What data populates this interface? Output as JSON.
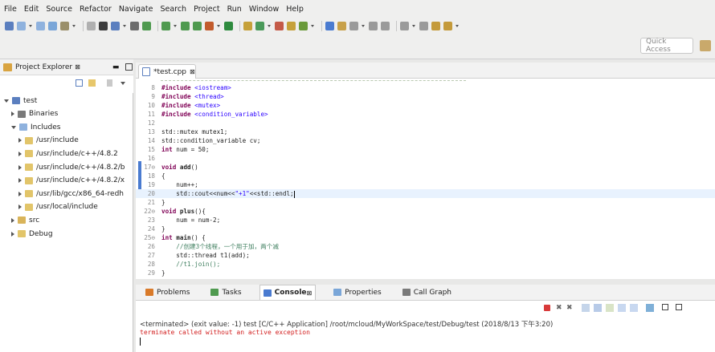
{
  "menu": [
    "File",
    "Edit",
    "Source",
    "Refactor",
    "Navigate",
    "Search",
    "Project",
    "Run",
    "Window",
    "Help"
  ],
  "quick_access": {
    "placeholder": "Quick Access"
  },
  "project_explorer": {
    "title": "Project Explorer",
    "close": "⊠",
    "tree": [
      {
        "label": "test",
        "arrow": "open",
        "indent": 0,
        "icon": "project-icon"
      },
      {
        "label": "Binaries",
        "arrow": "closed",
        "indent": 1,
        "icon": "binaries-icon"
      },
      {
        "label": "Includes",
        "arrow": "open",
        "indent": 1,
        "icon": "includes-icon"
      },
      {
        "label": "/usr/include",
        "arrow": "closed",
        "indent": 2,
        "icon": "folder-icon"
      },
      {
        "label": "/usr/include/c++/4.8.2",
        "arrow": "closed",
        "indent": 2,
        "icon": "folder-icon"
      },
      {
        "label": "/usr/include/c++/4.8.2/b",
        "arrow": "closed",
        "indent": 2,
        "icon": "folder-icon"
      },
      {
        "label": "/usr/include/c++/4.8.2/x",
        "arrow": "closed",
        "indent": 2,
        "icon": "folder-icon"
      },
      {
        "label": "/usr/lib/gcc/x86_64-redh",
        "arrow": "closed",
        "indent": 2,
        "icon": "folder-icon"
      },
      {
        "label": "/usr/local/include",
        "arrow": "closed",
        "indent": 2,
        "icon": "folder-icon"
      },
      {
        "label": "src",
        "arrow": "closed",
        "indent": 1,
        "icon": "source-folder-icon"
      },
      {
        "label": "Debug",
        "arrow": "closed",
        "indent": 1,
        "icon": "folder-icon"
      }
    ]
  },
  "editor": {
    "tab_label": "*test.cpp",
    "tab_close": "⊠",
    "lines": [
      {
        "num": "8",
        "html": "<span class=\"kw\">#include</span> <span class=\"str\">&lt;iostream&gt;</span>"
      },
      {
        "num": "9",
        "html": "<span class=\"kw\">#include</span> <span class=\"str\">&lt;thread&gt;</span>"
      },
      {
        "num": "10",
        "html": "<span class=\"kw\">#include</span> <span class=\"str\">&lt;mutex&gt;</span>"
      },
      {
        "num": "11",
        "html": "<span class=\"kw\">#include</span> <span class=\"str\">&lt;condition_variable&gt;</span>"
      },
      {
        "num": "12",
        "html": ""
      },
      {
        "num": "13",
        "html": "std::mutex mutex1;"
      },
      {
        "num": "14",
        "html": "std::condition_variable cv;"
      },
      {
        "num": "15",
        "html": "<span class=\"kw\">int</span> num = 50;"
      },
      {
        "num": "16",
        "html": ""
      },
      {
        "num": "17⊖",
        "html": "<span class=\"kw\">void</span> <b>add</b>()"
      },
      {
        "num": "18",
        "html": "{"
      },
      {
        "num": "19",
        "html": "    num++;"
      },
      {
        "num": "20",
        "html": "    std::cout&lt;&lt;num&lt;&lt;<span class=\"str\">\"+1\"</span>&lt;&lt;std::endl;",
        "current": true
      },
      {
        "num": "21",
        "html": "}"
      },
      {
        "num": "22⊖",
        "html": "<span class=\"kw\">void</span> <b>plus</b>(){"
      },
      {
        "num": "23",
        "html": "    num = num-2;"
      },
      {
        "num": "24",
        "html": "}"
      },
      {
        "num": "25⊖",
        "html": "<span class=\"kw\">int</span> <b>main</b>() {"
      },
      {
        "num": "26",
        "html": "    <span class=\"cmt\">//创建3个线程，一个用于加，两个减</span>"
      },
      {
        "num": "27",
        "html": "    std::thread t1(add);"
      },
      {
        "num": "28",
        "html": "    <span class=\"cmt\">//t1.join();</span>"
      },
      {
        "num": "29",
        "html": "}"
      }
    ]
  },
  "bottom_panel": {
    "tabs": [
      "Problems",
      "Tasks",
      "Console",
      "Properties",
      "Call Graph"
    ],
    "active_tab": "Console",
    "status": "<terminated> (exit value: -1) test [C/C++ Application] /root/mcloud/MyWorkSpace/test/Debug/test (2018/8/13 下午3:20)",
    "output": "terminate called without an active exception"
  },
  "colors": {
    "accent": "#4a7bd0",
    "keyword": "#7f0055",
    "string": "#2a00ff",
    "comment": "#3f7f5f",
    "error": "#d21e1e"
  }
}
